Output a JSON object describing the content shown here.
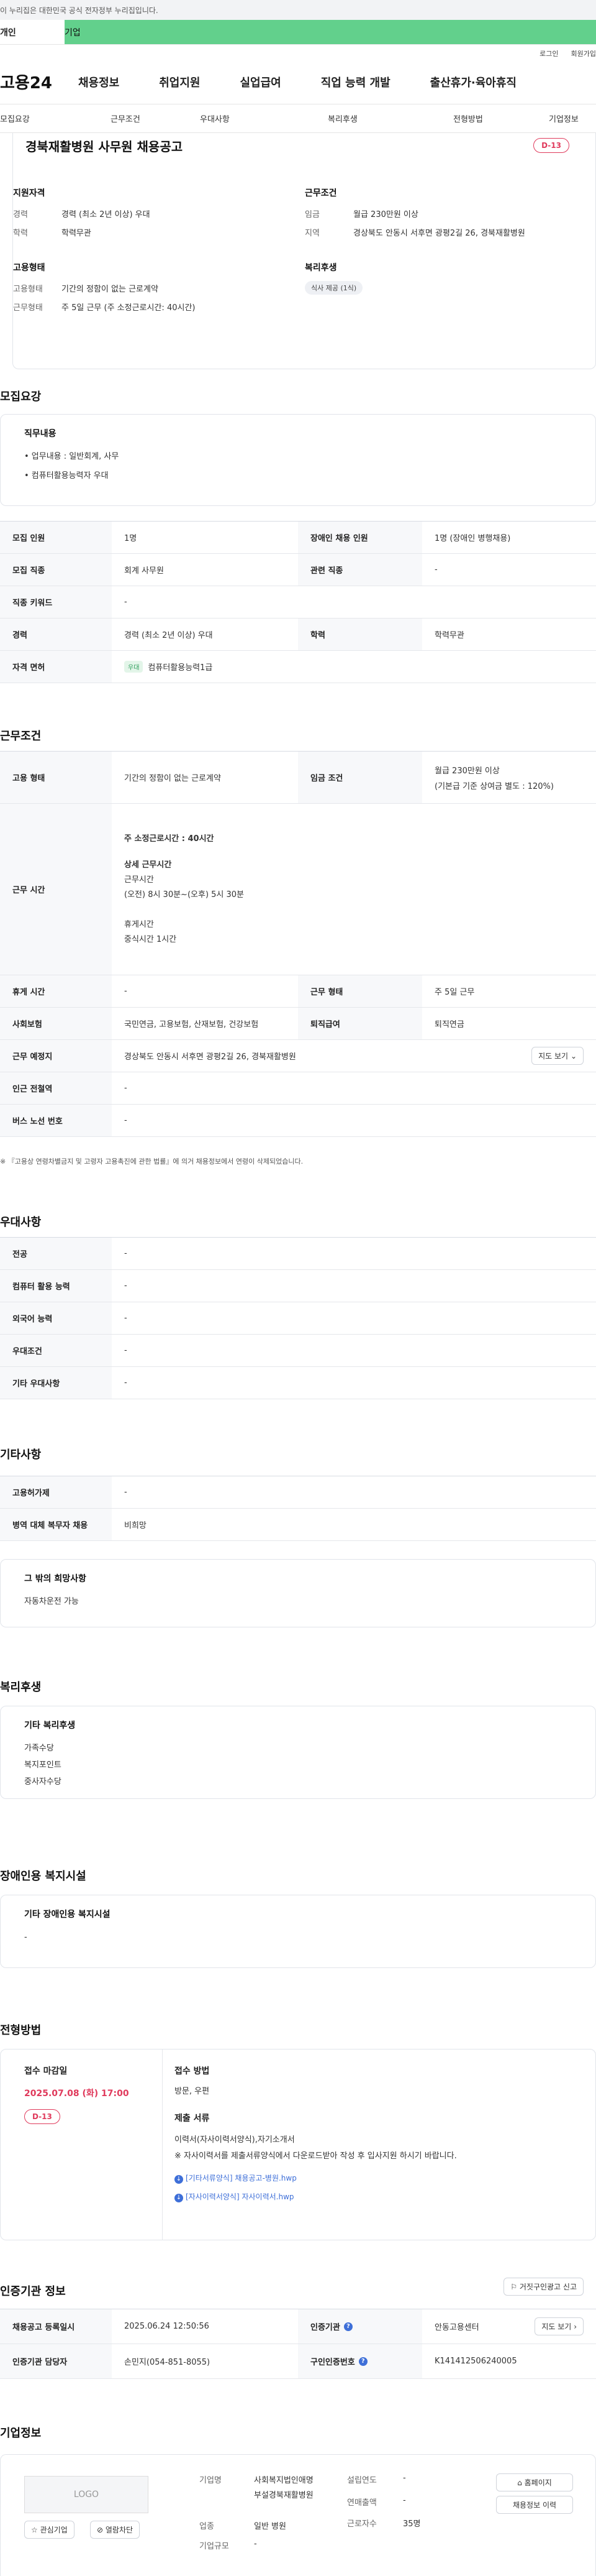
{
  "gov_banner": "이 누리집은 대한민국 공식 전자정부 누리집입니다.",
  "tabs": {
    "individual": "개인",
    "company": "기업"
  },
  "util": {
    "login": "로그인",
    "join": "회원가입"
  },
  "logo": "고용24",
  "main_nav": [
    "채용정보",
    "취업지원",
    "실업급여",
    "직업 능력 개발",
    "출산휴가·육아휴직"
  ],
  "sub_nav": [
    "모집요강",
    "근무조건",
    "우대사항",
    "복리후생",
    "전형방법",
    "기업정보"
  ],
  "header": {
    "title": "경북재활병원 사무원 채용공고",
    "dday": "D-13",
    "qual_label": "지원자격",
    "career_k": "경력",
    "career_v": "경력 (최소 2년 이상) 우대",
    "edu_k": "학력",
    "edu_v": "학력무관",
    "work_label": "근무조건",
    "wage_k": "임금",
    "wage_v": "월급 230만원 이상",
    "region_k": "지역",
    "region_v": "경상북도 안동시 서후면 광평2길 26, 경북재활병원",
    "emp_label": "고용형태",
    "emptype_k": "고용형태",
    "emptype_v": "기간의 정함이 없는 근로계약",
    "worktype_k": "근무형태",
    "worktype_v": "주 5일 근무 (주 소정근로시간: 40시간)",
    "welfare_label": "복리후생",
    "welfare_chip": "식사 제공 (1식)"
  },
  "recruit": {
    "title": "모집요강",
    "duty_h": "직무내용",
    "duty_1": "• 업무내용 : 일반회계, 사무",
    "duty_2": "• 컴퓨터활용능력자 우대",
    "rows": [
      {
        "k1": "모집 인원",
        "v1": "1명",
        "k2": "장애인 채용 인원",
        "v2": "1명 (장애인 병행채용)"
      },
      {
        "k1": "모집 직종",
        "v1": "회계 사무원",
        "k2": "관련 직종",
        "v2": "-"
      },
      {
        "k1": "직종 키워드",
        "v1": "-"
      },
      {
        "k1": "경력",
        "v1": "경력 (최소 2년 이상) 우대",
        "k2": "학력",
        "v2": "학력무관"
      },
      {
        "k1": "자격 면허",
        "badge": "우대",
        "v1": "컴퓨터활용능력1급"
      }
    ]
  },
  "conditions": {
    "title": "근무조건",
    "emptype_k": "고용 형태",
    "emptype_v": "기간의 정함이 없는 근로계약",
    "wage_k": "임금 조건",
    "wage_v1": "월급 230만원 이상",
    "wage_v2": "(기본급 기준 상여금 별도 : 120%)",
    "hours_k": "근무 시간",
    "hours_main": "주 소정근로시간 : 40시간",
    "hours_detail_h": "상세 근무시간",
    "hours_l1": "근무시간",
    "hours_l2": "(오전) 8시 30분~(오후) 5시 30분",
    "hours_l3": "휴게시간",
    "hours_l4": "중식시간 1시간",
    "break_k": "휴게 시간",
    "break_v": "-",
    "form_k": "근무 형태",
    "form_v": "주 5일 근무",
    "ins_k": "사회보험",
    "ins_v": "국민연금, 고용보험, 산재보험, 건강보험",
    "sev_k": "퇴직급여",
    "sev_v": "퇴직연금",
    "place_k": "근무 예정지",
    "place_v": "경상북도 안동시 서후면 광평2길 26, 경북재활병원",
    "map_btn": "지도 보기",
    "subway_k": "인근 전철역",
    "subway_v": "-",
    "bus_k": "버스 노선 번호",
    "bus_v": "-",
    "note": "※ 『고용상 연령차별금지 및 고령자 고용촉진에 관한 법률』에 의거 채용정보에서 연령이 삭제되었습니다."
  },
  "prefer": {
    "title": "우대사항",
    "rows": [
      {
        "k": "전공",
        "v": "-"
      },
      {
        "k": "컴퓨터 활용 능력",
        "v": "-"
      },
      {
        "k": "외국어 능력",
        "v": "-"
      },
      {
        "k": "우대조건",
        "v": "-"
      },
      {
        "k": "기타 우대사항",
        "v": "-"
      }
    ]
  },
  "etc": {
    "title": "기타사항",
    "rows": [
      {
        "k": "고용허가제",
        "v": "-"
      },
      {
        "k": "병역 대체 복무자 채용",
        "v": "비희망"
      }
    ],
    "box_h": "그 밖의 희망사항",
    "box_v": "자동차운전 가능"
  },
  "welfare": {
    "title": "복리후생",
    "box_h": "기타 복리후생",
    "items": [
      "가족수당",
      "복지포인트",
      "중사자수당"
    ]
  },
  "disability": {
    "title": "장애인용 복지시설",
    "box_h": "기타 장애인용 복지시설",
    "box_v": "-"
  },
  "selection": {
    "title": "전형방법",
    "deadline_h": "접수 마감일",
    "deadline_v": "2025.07.08 (화) 17:00",
    "dday": "D-13",
    "method_h": "접수 방법",
    "method_v": "방문, 우편",
    "docs_h": "제출 서류",
    "docs_v": "이력서(자사이력서양식),자기소개서",
    "docs_note": "※ 자사이력서를 제출서류양식에서 다운로드받아 작성 후 입사지원 하시기 바랍니다.",
    "file1": "[기타서류양식] 채용공고-병원.hwp",
    "file2": "[자사이력서양식] 자사이력서.hwp"
  },
  "cert": {
    "title": "인증기관 정보",
    "report_btn": "거짓구인광고 신고",
    "reg_k": "채용공고 등록일시",
    "reg_v": "2025.06.24 12:50:56",
    "org_k": "인증기관",
    "org_v": "안동고용센터",
    "map_btn": "지도 보기",
    "mgr_k": "인증기관 담당자",
    "mgr_v": "손민지(054-851-8055)",
    "no_k": "구인인증번호",
    "no_v": "K141412506240005"
  },
  "company": {
    "title": "기업정보",
    "logo_text": "LOGO",
    "fav_btn": "관심기업",
    "block_btn": "열람차단",
    "name_k": "기업명",
    "name_v1": "사회복지법인애명",
    "name_v2": "부설경북재활병원",
    "ind_k": "업종",
    "ind_v": "일반 병원",
    "size_k": "기업규모",
    "size_v": "-",
    "found_k": "설립연도",
    "found_v": "-",
    "sales_k": "연매출액",
    "sales_v": "-",
    "emp_k": "근로자수",
    "emp_v": "35명",
    "home_btn": "홈페이지",
    "jobs_btn": "채용정보 이력"
  },
  "colors": {
    "accent": "#62d08c",
    "dday": "#e03a5c",
    "link": "#3e6fd8"
  }
}
